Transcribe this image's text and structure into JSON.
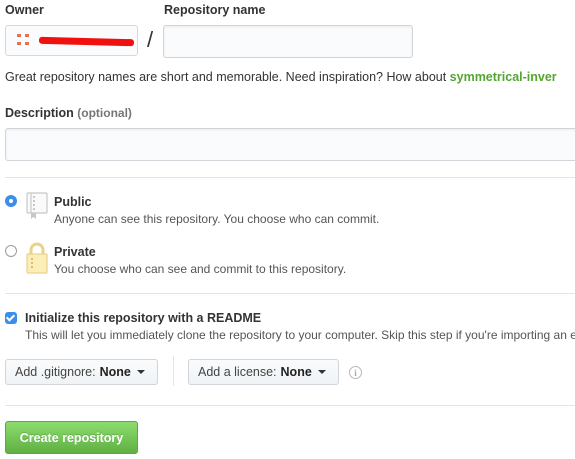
{
  "form": {
    "owner_label": "Owner",
    "repo_name_label": "Repository name",
    "slash": "/",
    "repo_name_value": "",
    "hint_text": "Great repository names are short and memorable. Need inspiration? How about ",
    "hint_suggestion": "symmetrical-inver",
    "description_label": "Description",
    "description_optional": "(optional)",
    "description_value": ""
  },
  "visibility": {
    "public_title": "Public",
    "public_desc": "Anyone can see this repository. You choose who can commit.",
    "public_selected": true,
    "private_title": "Private",
    "private_desc": "You choose who can see and commit to this repository.",
    "private_selected": false
  },
  "init": {
    "checked": true,
    "title": "Initialize this repository with a README",
    "desc": "This will let you immediately clone the repository to your computer. Skip this step if you're importing an e"
  },
  "dropdowns": {
    "gitignore_label": "Add .gitignore:",
    "gitignore_value": "None",
    "license_label": "Add a license:",
    "license_value": "None"
  },
  "actions": {
    "create_label": "Create repository"
  },
  "icons": {
    "owner_avatar": "identicon-avatar",
    "public_icon": "book-repo-icon",
    "private_icon": "lock-icon",
    "info_icon": "info-icon"
  },
  "colors": {
    "accent_blue": "#3b8eea",
    "suggestion_green": "#55a532",
    "create_button_green": "#60b044",
    "redaction_red": "#f01010"
  }
}
